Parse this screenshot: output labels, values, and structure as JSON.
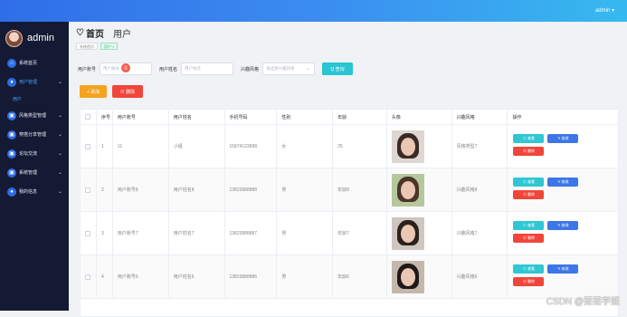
{
  "topbar": {
    "user": "admin ▾"
  },
  "sidebar": {
    "brand": "admin",
    "items": [
      {
        "label": "系统首页",
        "icon": "home-icon",
        "glyph": "⌂",
        "chevron": ""
      },
      {
        "label": "用户管理",
        "icon": "user-icon",
        "glyph": "●",
        "chevron": "⌄",
        "active": true
      },
      {
        "label": "风格类型管理",
        "icon": "grid-icon",
        "glyph": "▣",
        "chevron": "⌄"
      },
      {
        "label": "穿搭分享管理",
        "icon": "share-icon",
        "glyph": "▣",
        "chevron": "⌄"
      },
      {
        "label": "论坛交流",
        "icon": "chat-icon",
        "glyph": "▣",
        "chevron": "⌄"
      },
      {
        "label": "系统管理",
        "icon": "settings-icon",
        "glyph": "▣",
        "chevron": "⌄"
      },
      {
        "label": "我的信息",
        "icon": "profile-icon",
        "glyph": "●",
        "chevron": "⌄"
      }
    ],
    "sub_item": "用户"
  },
  "breadcrumb": {
    "home": "首页",
    "current": "用户"
  },
  "tags": [
    {
      "label": "系统首页",
      "active": false
    },
    {
      "label": "用户 ×",
      "active": true
    }
  ],
  "search": {
    "account_label": "用户账号",
    "account_placeholder": "用户账号",
    "name_label": "用户姓名",
    "name_placeholder": "用户姓名",
    "style_label": "兴趣风格",
    "style_placeholder": "请选择兴趣风格",
    "search_button": "Q 查询",
    "marker": "①"
  },
  "actions": {
    "add": "+ 添加",
    "delete": "⊖ 删除"
  },
  "table": {
    "headers": [
      "",
      "序号",
      "用户账号",
      "用户姓名",
      "手机号码",
      "性别",
      "年龄",
      "头像",
      "兴趣风格",
      "操作"
    ],
    "rows": [
      {
        "index": "1",
        "account": "11",
        "name": "小姐",
        "phone": "15874123698",
        "gender": "女",
        "age": "25",
        "style": "风格类型7",
        "hair": "#3a2a24",
        "bg": "#ddd6d2"
      },
      {
        "index": "2",
        "account": "用户账号8",
        "name": "用户姓名8",
        "phone": "13823888888",
        "gender": "男",
        "age": "年龄8",
        "style": "兴趣风格8",
        "hair": "#4a3528",
        "bg": "#b6c79e"
      },
      {
        "index": "3",
        "account": "用户账号7",
        "name": "用户姓名7",
        "phone": "13823888887",
        "gender": "男",
        "age": "年龄7",
        "style": "兴趣风格7",
        "hair": "#2b211d",
        "bg": "#cfc6c0"
      },
      {
        "index": "4",
        "account": "用户账号6",
        "name": "用户姓名6",
        "phone": "13823888886",
        "gender": "男",
        "age": "年龄6",
        "style": "兴趣风格6",
        "hair": "#1f1a18",
        "bg": "#c4b8ac"
      }
    ],
    "view_button": "⊙ 查看",
    "edit_button": "✎ 修改",
    "remove_button": "⊖ 删除"
  },
  "watermark": "CSDN @茹茹学姐"
}
